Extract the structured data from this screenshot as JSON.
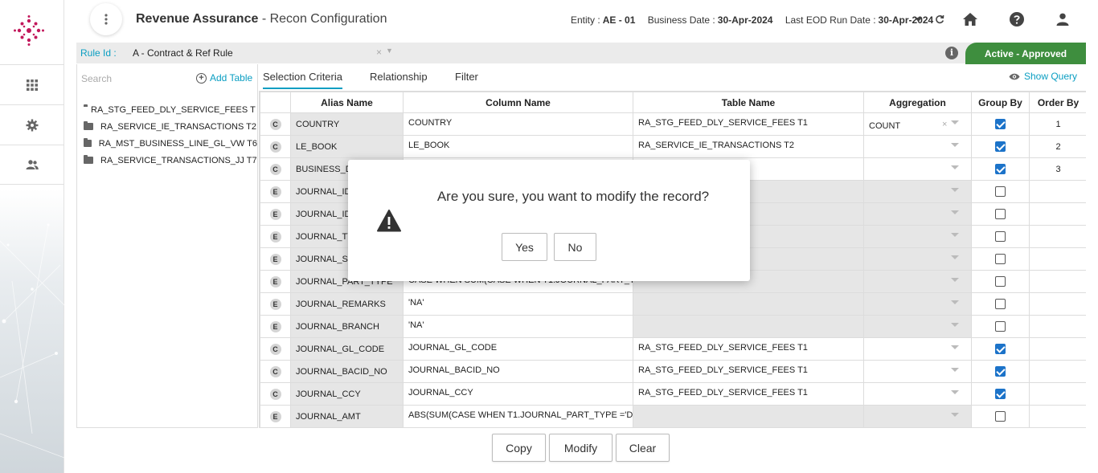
{
  "header": {
    "app_name": "Revenue Assurance",
    "page_name": " - Recon Configuration",
    "entity_label": "Entity :",
    "entity_value": "AE - 01",
    "business_date_label": "Business Date :",
    "business_date_value": "30-Apr-2024",
    "eod_label": "Last EOD Run Date :",
    "eod_value": "30-Apr-2024"
  },
  "rule": {
    "label": "Rule Id :",
    "value": "A - Contract & Ref Rule",
    "clear": "×",
    "info": "i"
  },
  "status": "Active - Approved",
  "left_pane": {
    "search_placeholder": "Search",
    "add_table": "Add Table",
    "tables": [
      "RA_STG_FEED_DLY_SERVICE_FEES T ...",
      "RA_SERVICE_IE_TRANSACTIONS T2",
      "RA_MST_BUSINESS_LINE_GL_VW T6",
      "RA_SERVICE_TRANSACTIONS_JJ T7"
    ]
  },
  "tabs": [
    "Selection Criteria",
    "Relationship",
    "Filter"
  ],
  "show_query": "Show Query",
  "grid": {
    "headers": [
      "Alias Name",
      "Column Name",
      "Table Name",
      "Aggregation",
      "Group By",
      "Order By"
    ],
    "rows": [
      {
        "type": "C",
        "alias": "COUNTRY",
        "column": "COUNTRY",
        "table": "RA_STG_FEED_DLY_SERVICE_FEES T1",
        "aggregation": "COUNT",
        "group_by": true,
        "order_by": "1"
      },
      {
        "type": "C",
        "alias": "LE_BOOK",
        "column": "LE_BOOK",
        "table": "RA_SERVICE_IE_TRANSACTIONS T2",
        "aggregation": "",
        "group_by": true,
        "order_by": "2"
      },
      {
        "type": "C",
        "alias": "BUSINESS_DA",
        "column": "",
        "table": "ONS T2",
        "aggregation": "",
        "group_by": true,
        "order_by": "3"
      },
      {
        "type": "E",
        "alias": "JOURNAL_ID",
        "column": "",
        "table": "",
        "aggregation": "",
        "group_by": false,
        "order_by": ""
      },
      {
        "type": "E",
        "alias": "JOURNAL_ID,",
        "column": "",
        "table": "",
        "aggregation": "",
        "group_by": false,
        "order_by": ""
      },
      {
        "type": "E",
        "alias": "JOURNAL_TY",
        "column": "",
        "table": "",
        "aggregation": "",
        "group_by": false,
        "order_by": ""
      },
      {
        "type": "E",
        "alias": "JOURNAL_SU",
        "column": "",
        "table": "",
        "aggregation": "",
        "group_by": false,
        "order_by": ""
      },
      {
        "type": "E",
        "alias": "JOURNAL_PART_TYPE",
        "column": "CASE WHEN SUM(CASE WHEN T1.JOURNAL_PART_TYP",
        "table": "",
        "aggregation": "",
        "group_by": false,
        "order_by": ""
      },
      {
        "type": "E",
        "alias": "JOURNAL_REMARKS",
        "column": "'NA'",
        "table": "",
        "aggregation": "",
        "group_by": false,
        "order_by": ""
      },
      {
        "type": "E",
        "alias": "JOURNAL_BRANCH",
        "column": "'NA'",
        "table": "",
        "aggregation": "",
        "group_by": false,
        "order_by": ""
      },
      {
        "type": "C",
        "alias": "JOURNAL_GL_CODE",
        "column": "JOURNAL_GL_CODE",
        "table": "RA_STG_FEED_DLY_SERVICE_FEES T1",
        "aggregation": "",
        "group_by": true,
        "order_by": ""
      },
      {
        "type": "C",
        "alias": "JOURNAL_BACID_NO",
        "column": "JOURNAL_BACID_NO",
        "table": "RA_STG_FEED_DLY_SERVICE_FEES T1",
        "aggregation": "",
        "group_by": true,
        "order_by": ""
      },
      {
        "type": "C",
        "alias": "JOURNAL_CCY",
        "column": "JOURNAL_CCY",
        "table": "RA_STG_FEED_DLY_SERVICE_FEES T1",
        "aggregation": "",
        "group_by": true,
        "order_by": ""
      },
      {
        "type": "E",
        "alias": "JOURNAL_AMT",
        "column": "ABS(SUM(CASE WHEN T1.JOURNAL_PART_TYPE ='D' TI",
        "table": "",
        "aggregation": "",
        "group_by": false,
        "order_by": ""
      }
    ]
  },
  "buttons": {
    "copy": "Copy",
    "modify": "Modify",
    "clear": "Clear"
  },
  "modal": {
    "message": "Are you sure, you want to modify the record?",
    "yes": "Yes",
    "no": "No"
  },
  "colors": {
    "accent": "#0a9ec2",
    "status_bg": "#3e8e3e",
    "checkbox": "#1c73c9"
  }
}
